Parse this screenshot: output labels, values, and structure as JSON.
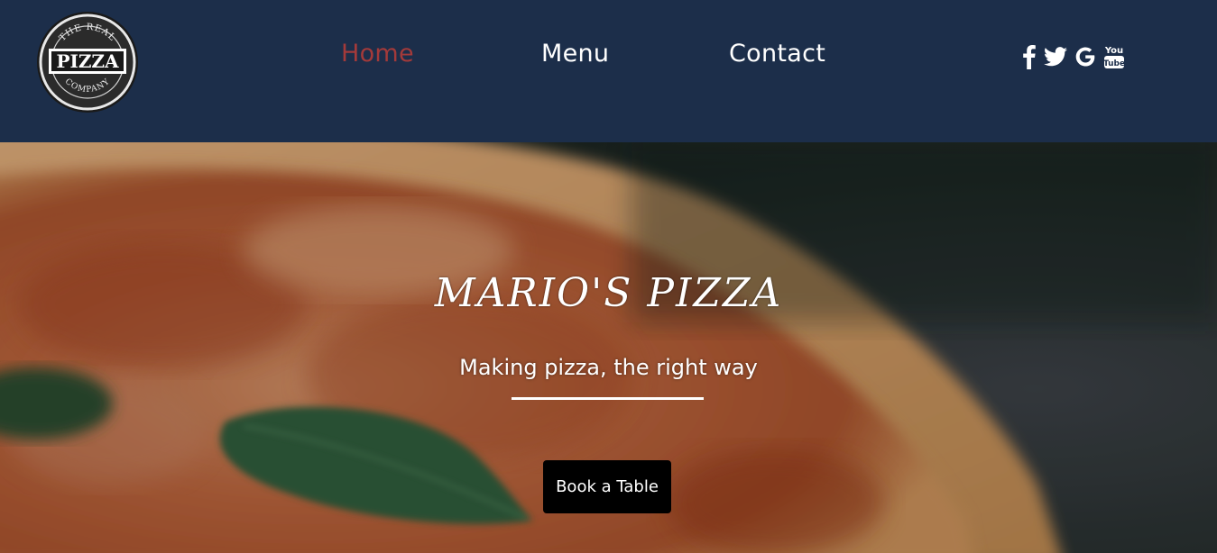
{
  "logo": {
    "top_text": "THE REAL",
    "main_text": "PIZZA",
    "bottom_text": "COMPANY"
  },
  "nav": {
    "items": [
      {
        "label": "Home",
        "active": true
      },
      {
        "label": "Menu",
        "active": false
      },
      {
        "label": "Contact",
        "active": false
      }
    ]
  },
  "social": {
    "icons": [
      "facebook-icon",
      "twitter-icon",
      "google-icon",
      "youtube-icon"
    ],
    "youtube_top": "You",
    "youtube_bottom": "Tube"
  },
  "hero": {
    "title": "MARIO'S PIZZA",
    "subtitle": "Making pizza, the right way",
    "button_label": "Book a Table"
  },
  "colors": {
    "header_bg": "#1c2e4a",
    "nav_active": "#a33a3a",
    "nav_text": "#ffffff",
    "button_bg": "#000000"
  }
}
